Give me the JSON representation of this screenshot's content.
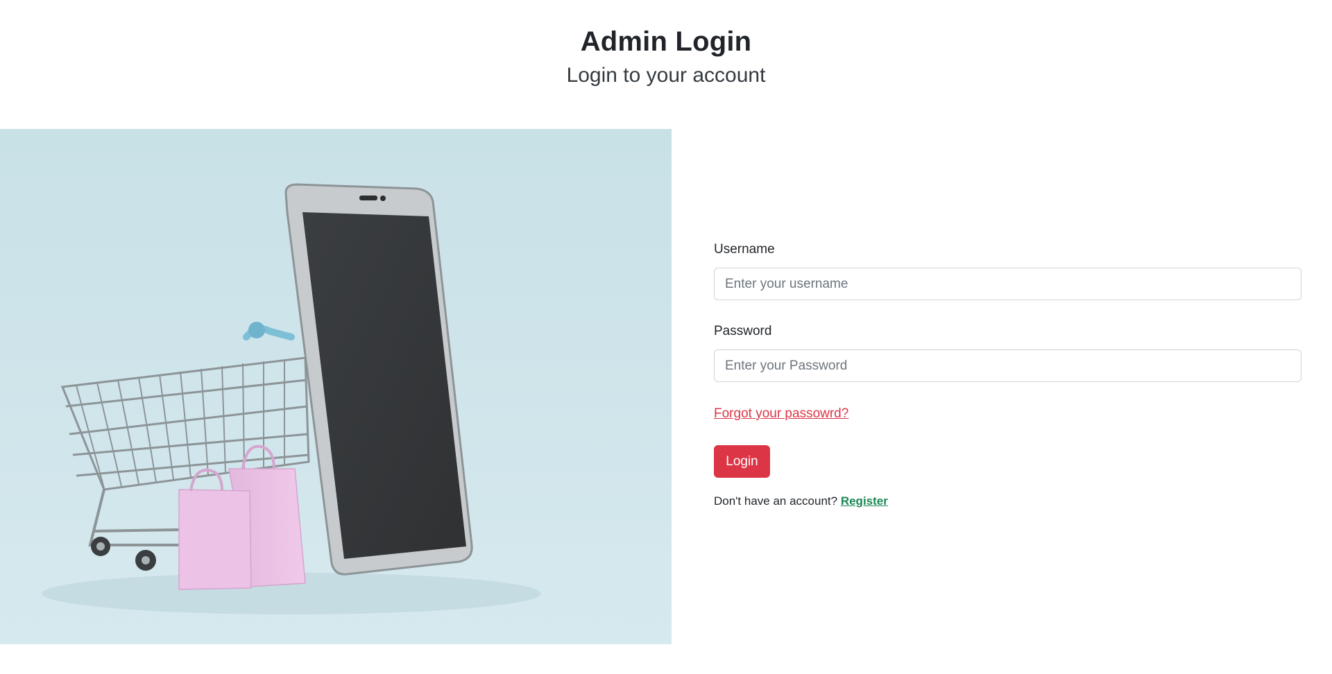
{
  "header": {
    "title": "Admin Login",
    "subtitle": "Login to your account"
  },
  "hero": {
    "icon": "shopping-cart-phone-bags-illustration"
  },
  "form": {
    "username": {
      "label": "Username",
      "placeholder": "Enter your username",
      "value": ""
    },
    "password": {
      "label": "Password",
      "placeholder": "Enter your Password",
      "value": ""
    },
    "forgot_label": "Forgot your passowrd?",
    "login_label": "Login",
    "register_prompt": "Don't have an account?",
    "register_label": "Register"
  },
  "colors": {
    "accent": "#dc3545",
    "register": "#198754",
    "hero_background": "#c9e1e7"
  }
}
